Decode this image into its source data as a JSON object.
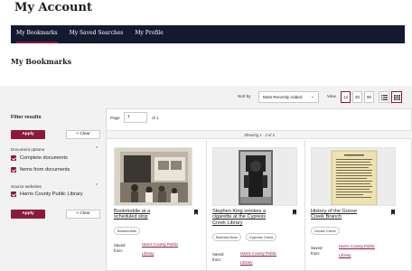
{
  "page_title": "My Account",
  "nav": {
    "tabs": [
      {
        "label": "My Bookmarks",
        "active": true
      },
      {
        "label": "My Saved Searches",
        "active": false
      },
      {
        "label": "My Profile",
        "active": false
      }
    ]
  },
  "section_heading": "My Bookmarks",
  "toolbar": {
    "sort_label": "Sort by",
    "sort_value": "Most Recently Added",
    "view_label": "View",
    "view_options": [
      "12",
      "30",
      "90"
    ],
    "view_selected": "12",
    "layouts": [
      {
        "icon": "list-view-icon",
        "active": false
      },
      {
        "icon": "grid-view-icon",
        "active": true
      }
    ]
  },
  "filters": {
    "title": "Filter results",
    "apply_label": "Apply",
    "clear_label": "Clear",
    "document_options": {
      "label": "Document options",
      "items": [
        {
          "label": "Complete documents",
          "checked": true
        },
        {
          "label": "Items from documents",
          "checked": true
        }
      ]
    },
    "source_websites": {
      "label": "Source websites",
      "items": [
        {
          "label": "Harris County Public Library",
          "checked": true
        }
      ]
    }
  },
  "pagination": {
    "page_label": "Page",
    "current_page": "1",
    "of_text": "of 1"
  },
  "showing_text": "Showing 1 - 3 of 3",
  "cards": [
    {
      "title_line1": "Bookmobile at a",
      "title_line2": "scheduled stop",
      "title_line3": "",
      "tags": [
        "Bookmobile"
      ],
      "saved_label_line1": "Saved",
      "saved_label_line2": "from:",
      "saved_link_line1": "Harris County Public",
      "saved_link_line2": "Library"
    },
    {
      "title_line1": "Stephen King smokes a",
      "title_line2": "cigarette at the Cypress",
      "title_line3": "Creek Library",
      "tags": [
        "Barbara Bush",
        "Cypress Creek"
      ],
      "saved_label_line1": "Saved",
      "saved_label_line2": "from:",
      "saved_link_line1": "Harris County Public",
      "saved_link_line2": "Library"
    },
    {
      "title_line1": "History of the Goose",
      "title_line2": "Creek Branch",
      "title_line3": "",
      "tags": [
        "Goose Creek"
      ],
      "saved_label_line1": "Saved",
      "saved_label_line2": "from:",
      "saved_link_line1": "Harris County Public",
      "saved_link_line2": "Library"
    }
  ],
  "colors": {
    "brand": "#8b1a3a",
    "navbar": "#111a2e"
  }
}
